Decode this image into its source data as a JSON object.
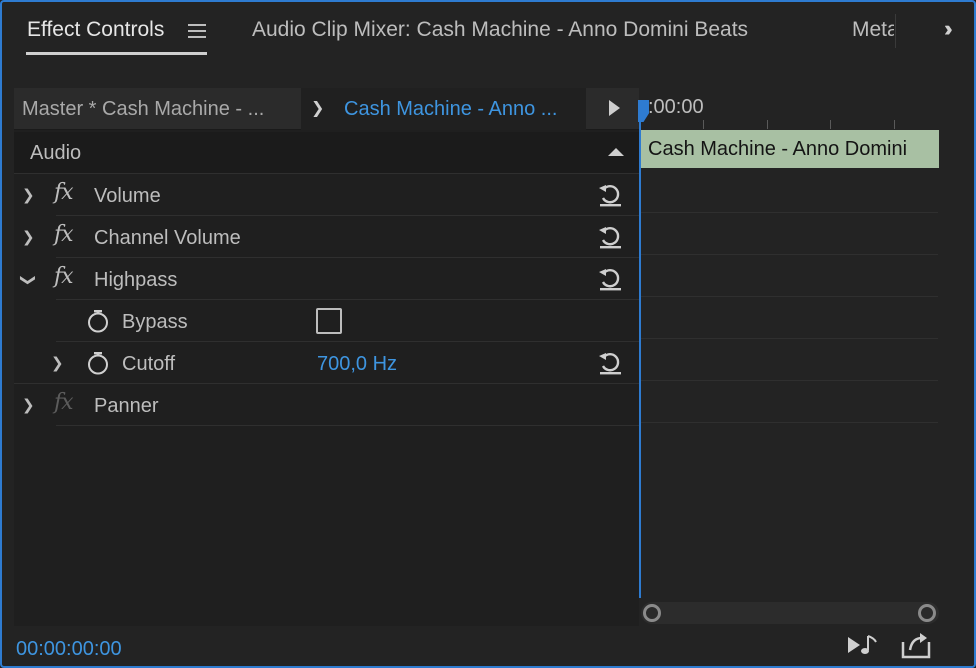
{
  "tabs": {
    "active": "Effect Controls",
    "mixer": "Audio Clip Mixer: Cash Machine - Anno Domini Beats",
    "meta": "Meta"
  },
  "header": {
    "master": "Master * Cash Machine - ...",
    "clip": "Cash Machine - Anno ..."
  },
  "section": {
    "label": "Audio"
  },
  "effects": [
    {
      "name": "Volume",
      "expanded": false,
      "enabled": true
    },
    {
      "name": "Channel Volume",
      "expanded": false,
      "enabled": true
    },
    {
      "name": "Highpass",
      "expanded": true,
      "enabled": true
    },
    {
      "name": "Panner",
      "expanded": false,
      "enabled": false
    }
  ],
  "params": {
    "bypass": {
      "label": "Bypass",
      "checked": false
    },
    "cutoff": {
      "label": "Cutoff",
      "value": "700,0 Hz"
    }
  },
  "timeline": {
    "start_time": ":00:00",
    "clip_label": "Cash Machine - Anno Domini"
  },
  "footer": {
    "timecode": "00:00:00:00"
  },
  "fx_glyph": "fx",
  "colors": {
    "accent": "#3e95e0",
    "clip": "#a8c0a3",
    "border": "#2e7bd0"
  }
}
